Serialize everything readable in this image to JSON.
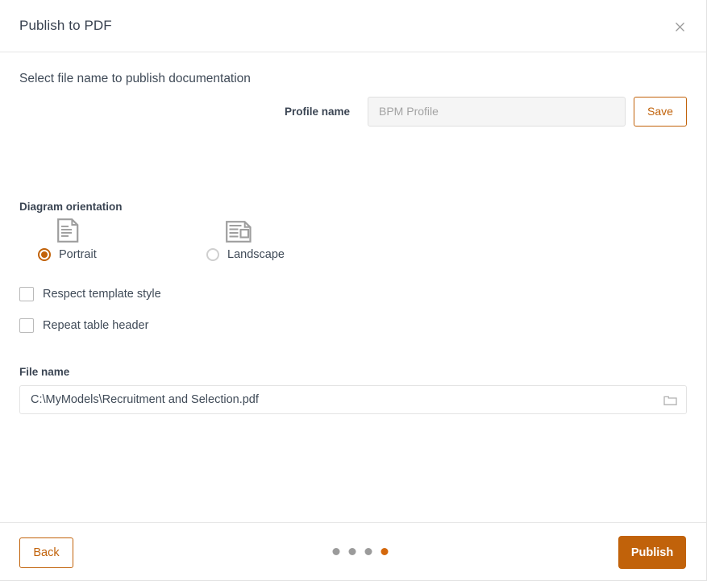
{
  "dialog": {
    "title": "Publish to PDF",
    "close_icon": "close-icon",
    "intro": "Select file name to publish documentation"
  },
  "profile": {
    "label": "Profile name",
    "value": "",
    "placeholder": "BPM Profile",
    "save_label": "Save"
  },
  "orientation": {
    "label": "Diagram orientation",
    "selected": "Portrait",
    "options": [
      {
        "label": "Portrait",
        "icon": "portrait-document-icon",
        "selected": true
      },
      {
        "label": "Landscape",
        "icon": "landscape-document-icon",
        "selected": false
      }
    ]
  },
  "options": [
    {
      "label": "Respect template style",
      "checked": false
    },
    {
      "label": "Repeat table header",
      "checked": false
    }
  ],
  "file": {
    "label": "File name",
    "value": "C:\\MyModels\\Recruitment and Selection.pdf",
    "placeholder": "",
    "browse_icon": "folder-icon"
  },
  "footer": {
    "back_label": "Back",
    "publish_label": "Publish",
    "steps_total": 4,
    "step_active": 4
  },
  "colors": {
    "accent": "#c1620a",
    "accent_dot": "#d4680c",
    "dot_inactive": "#9b9b9b",
    "title_text": "#38414f",
    "body_text": "#3f4a57",
    "border": "#e6e6e6",
    "input_bg_disabled": "#f5f5f5"
  }
}
